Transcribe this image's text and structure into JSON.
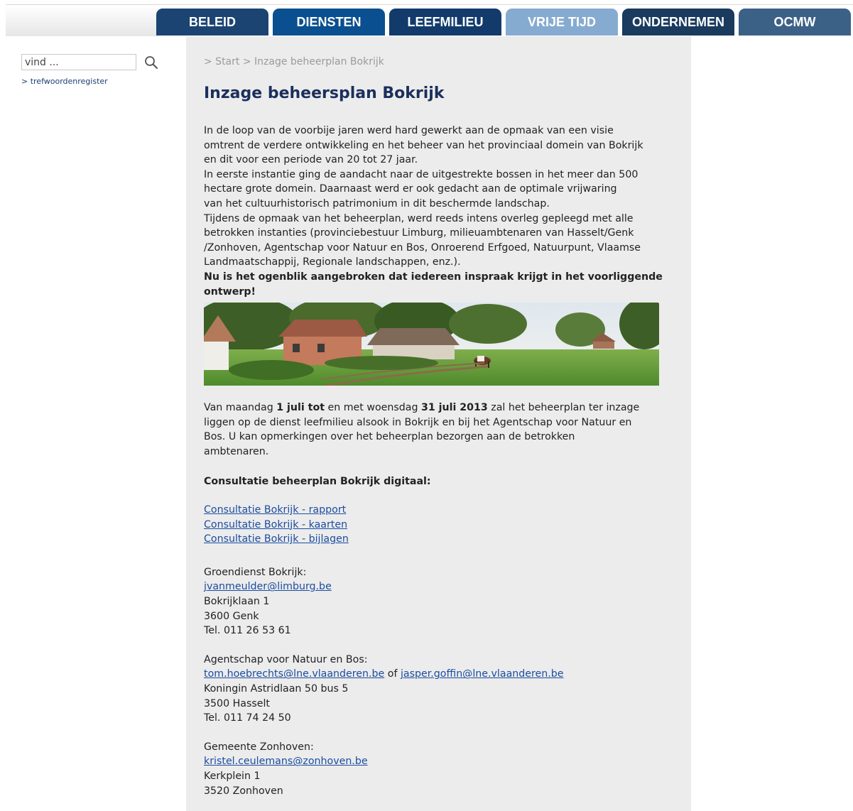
{
  "nav": {
    "tabs": [
      {
        "label": "BELEID"
      },
      {
        "label": "DIENSTEN"
      },
      {
        "label": "LEEFMILIEU"
      },
      {
        "label": "VRIJE TIJD"
      },
      {
        "label": "ONDERNEMEN"
      },
      {
        "label": "OCMW"
      }
    ]
  },
  "sidebar": {
    "search_value": "vind ...",
    "index_link": "> trefwoordenregister"
  },
  "main": {
    "breadcrumb": "> Start > Inzage beheerplan Bokrijk",
    "title": "Inzage beheersplan Bokrijk",
    "intro_lines": [
      "In de loop van de voorbije jaren werd hard gewerkt aan de opmaak van een visie",
      "omtrent de verdere ontwikkeling en het beheer van het provinciaal domein van Bokrijk",
      "en dit voor een periode van 20 tot 27 jaar.",
      "In eerste instantie ging de aandacht naar de uitgestrekte bossen in het meer dan 500",
      "hectare grote domein. Daarnaast werd er ook gedacht aan de optimale vrijwaring",
      "van het cultuurhistorisch patrimonium in dit beschermde landschap.",
      "Tijdens de opmaak van het beheerplan, werd reeds intens overleg gepleegd met alle",
      "betrokken instanties (provinciebestuur Limburg, milieuambtenaren van Hasselt/Genk",
      "/Zonhoven, Agentschap voor Natuur en Bos, Onroerend Erfgoed, Natuurpunt, Vlaamse",
      "Landmaatschappij, Regionale landschappen, enz.)."
    ],
    "callout_lines": [
      "Nu is het ogenblik aangebroken dat iedereen inspraak krijgt in het voorliggende",
      "ontwerp!"
    ],
    "dates": {
      "p1": "Van maandag ",
      "b1": "1 juli tot",
      "p2": " en met woensdag ",
      "b2": "31 juli 2013",
      "p3": " zal het beheerplan ter inzage",
      "l2": "liggen op de dienst leefmilieu alsook in Bokrijk en bij het Agentschap voor Natuur en",
      "l3": "Bos. U kan opmerkingen over het beheerplan bezorgen aan de betrokken",
      "l4": "ambtenaren."
    },
    "consult_heading": "Consultatie beheerplan Bokrijk digitaal:",
    "links": [
      "Consultatie Bokrijk - rapport",
      "Consultatie Bokrijk - kaarten",
      "Consultatie Bokrijk - bijlagen"
    ],
    "contacts": [
      {
        "org": "Groendienst Bokrijk:",
        "email": "jvanmeulder@limburg.be",
        "street": "Bokrijklaan 1",
        "city": "3600 Genk",
        "phone": "Tel. 011 26 53 61"
      },
      {
        "org": "Agentschap voor Natuur en Bos:",
        "email": "tom.hoebrechts@lne.vlaanderen.be",
        "joiner": " of ",
        "email2": "jasper.goffin@lne.vlaanderen.be",
        "street": "Koningin Astridlaan 50 bus 5",
        "city": "3500 Hasselt",
        "phone": "Tel. 011 74 24 50"
      },
      {
        "org": "Gemeente Zonhoven:",
        "email": "kristel.ceulemans@zonhoven.be",
        "street": "Kerkplein 1",
        "city": "3520 Zonhoven"
      }
    ]
  }
}
